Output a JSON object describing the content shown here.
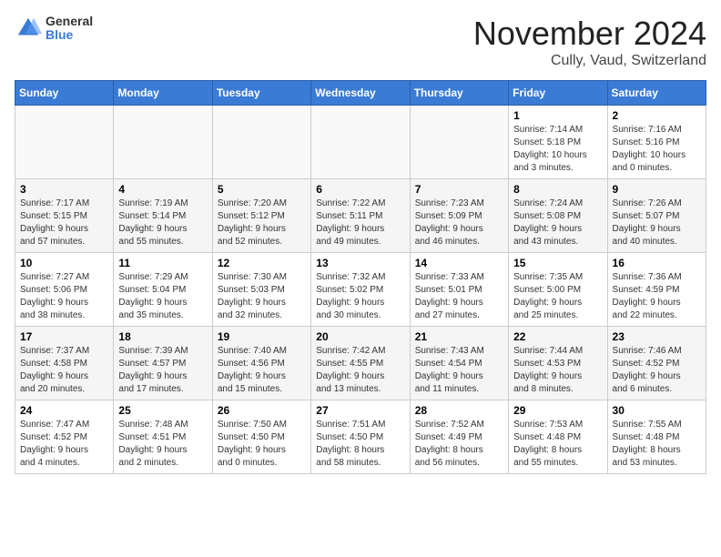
{
  "header": {
    "logo_general": "General",
    "logo_blue": "Blue",
    "month": "November 2024",
    "location": "Cully, Vaud, Switzerland"
  },
  "weekdays": [
    "Sunday",
    "Monday",
    "Tuesday",
    "Wednesday",
    "Thursday",
    "Friday",
    "Saturday"
  ],
  "weeks": [
    [
      {
        "day": "",
        "info": ""
      },
      {
        "day": "",
        "info": ""
      },
      {
        "day": "",
        "info": ""
      },
      {
        "day": "",
        "info": ""
      },
      {
        "day": "",
        "info": ""
      },
      {
        "day": "1",
        "info": "Sunrise: 7:14 AM\nSunset: 5:18 PM\nDaylight: 10 hours\nand 3 minutes."
      },
      {
        "day": "2",
        "info": "Sunrise: 7:16 AM\nSunset: 5:16 PM\nDaylight: 10 hours\nand 0 minutes."
      }
    ],
    [
      {
        "day": "3",
        "info": "Sunrise: 7:17 AM\nSunset: 5:15 PM\nDaylight: 9 hours\nand 57 minutes."
      },
      {
        "day": "4",
        "info": "Sunrise: 7:19 AM\nSunset: 5:14 PM\nDaylight: 9 hours\nand 55 minutes."
      },
      {
        "day": "5",
        "info": "Sunrise: 7:20 AM\nSunset: 5:12 PM\nDaylight: 9 hours\nand 52 minutes."
      },
      {
        "day": "6",
        "info": "Sunrise: 7:22 AM\nSunset: 5:11 PM\nDaylight: 9 hours\nand 49 minutes."
      },
      {
        "day": "7",
        "info": "Sunrise: 7:23 AM\nSunset: 5:09 PM\nDaylight: 9 hours\nand 46 minutes."
      },
      {
        "day": "8",
        "info": "Sunrise: 7:24 AM\nSunset: 5:08 PM\nDaylight: 9 hours\nand 43 minutes."
      },
      {
        "day": "9",
        "info": "Sunrise: 7:26 AM\nSunset: 5:07 PM\nDaylight: 9 hours\nand 40 minutes."
      }
    ],
    [
      {
        "day": "10",
        "info": "Sunrise: 7:27 AM\nSunset: 5:06 PM\nDaylight: 9 hours\nand 38 minutes."
      },
      {
        "day": "11",
        "info": "Sunrise: 7:29 AM\nSunset: 5:04 PM\nDaylight: 9 hours\nand 35 minutes."
      },
      {
        "day": "12",
        "info": "Sunrise: 7:30 AM\nSunset: 5:03 PM\nDaylight: 9 hours\nand 32 minutes."
      },
      {
        "day": "13",
        "info": "Sunrise: 7:32 AM\nSunset: 5:02 PM\nDaylight: 9 hours\nand 30 minutes."
      },
      {
        "day": "14",
        "info": "Sunrise: 7:33 AM\nSunset: 5:01 PM\nDaylight: 9 hours\nand 27 minutes."
      },
      {
        "day": "15",
        "info": "Sunrise: 7:35 AM\nSunset: 5:00 PM\nDaylight: 9 hours\nand 25 minutes."
      },
      {
        "day": "16",
        "info": "Sunrise: 7:36 AM\nSunset: 4:59 PM\nDaylight: 9 hours\nand 22 minutes."
      }
    ],
    [
      {
        "day": "17",
        "info": "Sunrise: 7:37 AM\nSunset: 4:58 PM\nDaylight: 9 hours\nand 20 minutes."
      },
      {
        "day": "18",
        "info": "Sunrise: 7:39 AM\nSunset: 4:57 PM\nDaylight: 9 hours\nand 17 minutes."
      },
      {
        "day": "19",
        "info": "Sunrise: 7:40 AM\nSunset: 4:56 PM\nDaylight: 9 hours\nand 15 minutes."
      },
      {
        "day": "20",
        "info": "Sunrise: 7:42 AM\nSunset: 4:55 PM\nDaylight: 9 hours\nand 13 minutes."
      },
      {
        "day": "21",
        "info": "Sunrise: 7:43 AM\nSunset: 4:54 PM\nDaylight: 9 hours\nand 11 minutes."
      },
      {
        "day": "22",
        "info": "Sunrise: 7:44 AM\nSunset: 4:53 PM\nDaylight: 9 hours\nand 8 minutes."
      },
      {
        "day": "23",
        "info": "Sunrise: 7:46 AM\nSunset: 4:52 PM\nDaylight: 9 hours\nand 6 minutes."
      }
    ],
    [
      {
        "day": "24",
        "info": "Sunrise: 7:47 AM\nSunset: 4:52 PM\nDaylight: 9 hours\nand 4 minutes."
      },
      {
        "day": "25",
        "info": "Sunrise: 7:48 AM\nSunset: 4:51 PM\nDaylight: 9 hours\nand 2 minutes."
      },
      {
        "day": "26",
        "info": "Sunrise: 7:50 AM\nSunset: 4:50 PM\nDaylight: 9 hours\nand 0 minutes."
      },
      {
        "day": "27",
        "info": "Sunrise: 7:51 AM\nSunset: 4:50 PM\nDaylight: 8 hours\nand 58 minutes."
      },
      {
        "day": "28",
        "info": "Sunrise: 7:52 AM\nSunset: 4:49 PM\nDaylight: 8 hours\nand 56 minutes."
      },
      {
        "day": "29",
        "info": "Sunrise: 7:53 AM\nSunset: 4:48 PM\nDaylight: 8 hours\nand 55 minutes."
      },
      {
        "day": "30",
        "info": "Sunrise: 7:55 AM\nSunset: 4:48 PM\nDaylight: 8 hours\nand 53 minutes."
      }
    ]
  ]
}
